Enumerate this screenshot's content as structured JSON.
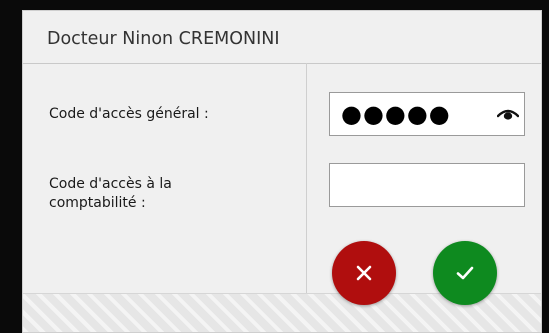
{
  "dialog": {
    "title": "Docteur Ninon CREMONINI"
  },
  "form": {
    "general_access_label": "Code d'accès général :",
    "general_access_value": "●●●●●",
    "accounting_access_label_line1": "Code d'accès à la",
    "accounting_access_label_line2": "comptabilité :",
    "accounting_access_value": ""
  },
  "icons": {
    "reveal_password": "eye-icon",
    "cancel": "close-icon",
    "confirm": "check-icon"
  },
  "colors": {
    "cancel_button": "#b00e0e",
    "confirm_button": "#0e8a1f"
  }
}
